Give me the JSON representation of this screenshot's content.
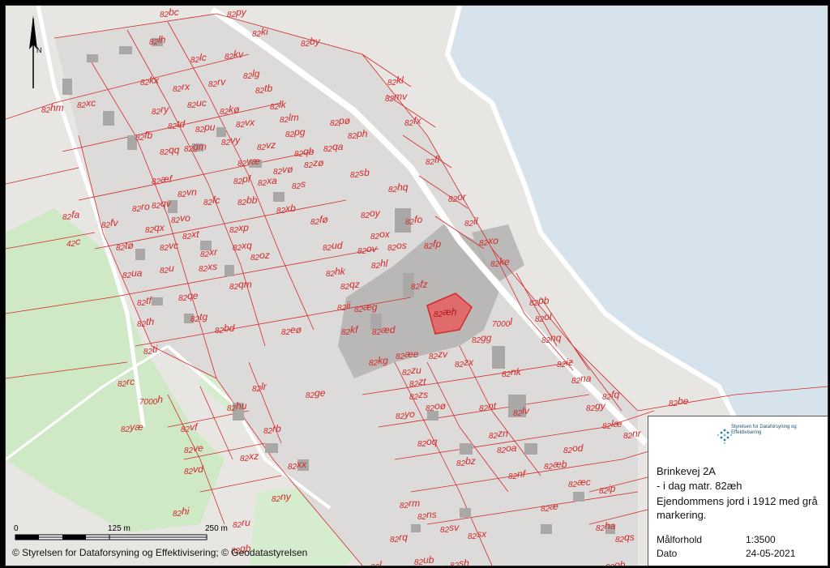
{
  "map": {
    "colors": {
      "water": "#d7e3ec",
      "land": "#e8e6e3",
      "green": "#cfe8c6",
      "built_area": "#d9d8d6",
      "highlight_gray": "#a8a8a8",
      "parcel_line": "#d42a2a",
      "highlight_parcel": "#e06b6b"
    },
    "parcels": [
      {
        "num": "82",
        "id": "bc"
      },
      {
        "num": "82",
        "id": "py"
      },
      {
        "num": "82",
        "id": "ki"
      },
      {
        "num": "82",
        "id": "by"
      },
      {
        "num": "82",
        "id": "lh"
      },
      {
        "num": "82",
        "id": "lc"
      },
      {
        "num": "82",
        "id": "kv"
      },
      {
        "num": "82",
        "id": "kx"
      },
      {
        "num": "82",
        "id": "lg"
      },
      {
        "num": "82",
        "id": "rx"
      },
      {
        "num": "82",
        "id": "rv"
      },
      {
        "num": "82",
        "id": "kl"
      },
      {
        "num": "82",
        "id": "mv"
      },
      {
        "num": "82",
        "id": "tb"
      },
      {
        "num": "82",
        "id": "hm"
      },
      {
        "num": "82",
        "id": "xc"
      },
      {
        "num": "82",
        "id": "uc"
      },
      {
        "num": "82",
        "id": "lk"
      },
      {
        "num": "82",
        "id": "ry"
      },
      {
        "num": "82",
        "id": "kø"
      },
      {
        "num": "82",
        "id": "lm"
      },
      {
        "num": "82",
        "id": "fx"
      },
      {
        "num": "82",
        "id": "td"
      },
      {
        "num": "82",
        "id": "pø"
      },
      {
        "num": "82",
        "id": "vx"
      },
      {
        "num": "82",
        "id": "pg"
      },
      {
        "num": "82",
        "id": "pu"
      },
      {
        "num": "82",
        "id": "ph"
      },
      {
        "num": "82",
        "id": "fb"
      },
      {
        "num": "82",
        "id": "vy"
      },
      {
        "num": "82",
        "id": "vz"
      },
      {
        "num": "82",
        "id": "gm"
      },
      {
        "num": "82",
        "id": "qa"
      },
      {
        "num": "82",
        "id": "qb"
      },
      {
        "num": "82",
        "id": "qq"
      },
      {
        "num": "82",
        "id": "fl"
      },
      {
        "num": "82",
        "id": "væ"
      },
      {
        "num": "82",
        "id": "zø"
      },
      {
        "num": "82",
        "id": "vø"
      },
      {
        "num": "82",
        "id": "sb"
      },
      {
        "num": "82",
        "id": "æf"
      },
      {
        "num": "82",
        "id": "pf"
      },
      {
        "num": "82",
        "id": "xa"
      },
      {
        "num": "82",
        "id": "hq"
      },
      {
        "num": "82",
        "id": "vn"
      },
      {
        "num": "82",
        "id": "s"
      },
      {
        "num": "82",
        "id": "or"
      },
      {
        "num": "82",
        "id": "fc"
      },
      {
        "num": "82",
        "id": "bb"
      },
      {
        "num": "82",
        "id": "qv"
      },
      {
        "num": "82",
        "id": "ro"
      },
      {
        "num": "82",
        "id": "xb"
      },
      {
        "num": "82",
        "id": "oy"
      },
      {
        "num": "82",
        "id": "fa"
      },
      {
        "num": "82",
        "id": "vo"
      },
      {
        "num": "82",
        "id": "fø"
      },
      {
        "num": "82",
        "id": "fo"
      },
      {
        "num": "82",
        "id": "il"
      },
      {
        "num": "82",
        "id": "fv"
      },
      {
        "num": "82",
        "id": "qx"
      },
      {
        "num": "82",
        "id": "xp"
      },
      {
        "num": "42",
        "id": "c"
      },
      {
        "num": "82",
        "id": "xt"
      },
      {
        "num": "82",
        "id": "ox"
      },
      {
        "num": "82",
        "id": "fp"
      },
      {
        "num": "82",
        "id": "xo"
      },
      {
        "num": "82",
        "id": "tø"
      },
      {
        "num": "82",
        "id": "vc"
      },
      {
        "num": "82",
        "id": "xq"
      },
      {
        "num": "82",
        "id": "ud"
      },
      {
        "num": "82",
        "id": "ov"
      },
      {
        "num": "82",
        "id": "os"
      },
      {
        "num": "82",
        "id": "xr"
      },
      {
        "num": "82",
        "id": "oz"
      },
      {
        "num": "82",
        "id": "ke"
      },
      {
        "num": "82",
        "id": "u"
      },
      {
        "num": "82",
        "id": "xs"
      },
      {
        "num": "82",
        "id": "hl"
      },
      {
        "num": "82",
        "id": "ua"
      },
      {
        "num": "82",
        "id": "hk"
      },
      {
        "num": "82",
        "id": "qm"
      },
      {
        "num": "82",
        "id": "qz"
      },
      {
        "num": "82",
        "id": "fz"
      },
      {
        "num": "82",
        "id": "tf"
      },
      {
        "num": "82",
        "id": "qe"
      },
      {
        "num": "82",
        "id": "pb"
      },
      {
        "num": "82",
        "id": "ii"
      },
      {
        "num": "82",
        "id": "æg"
      },
      {
        "num": "82",
        "id": "æh"
      },
      {
        "num": "82",
        "id": "ol"
      },
      {
        "num": "82",
        "id": "th"
      },
      {
        "num": "82",
        "id": "tg"
      },
      {
        "num": "7000",
        "id": "l"
      },
      {
        "num": "82",
        "id": "bd"
      },
      {
        "num": "82",
        "id": "eø"
      },
      {
        "num": "82",
        "id": "kf"
      },
      {
        "num": "82",
        "id": "æd"
      },
      {
        "num": "82",
        "id": "gg"
      },
      {
        "num": "82",
        "id": "nq"
      },
      {
        "num": "82",
        "id": "ti"
      },
      {
        "num": "82",
        "id": "æe"
      },
      {
        "num": "82",
        "id": "zv"
      },
      {
        "num": "82",
        "id": "kg"
      },
      {
        "num": "82",
        "id": "iz"
      },
      {
        "num": "82",
        "id": "zx"
      },
      {
        "num": "82",
        "id": "zu"
      },
      {
        "num": "82",
        "id": "nk"
      },
      {
        "num": "82",
        "id": "rc"
      },
      {
        "num": "82",
        "id": "na"
      },
      {
        "num": "82",
        "id": "lr"
      },
      {
        "num": "82",
        "id": "zt"
      },
      {
        "num": "82",
        "id": "fq"
      },
      {
        "num": "82",
        "id": "ge"
      },
      {
        "num": "82",
        "id": "zs"
      },
      {
        "num": "82",
        "id": "gy"
      },
      {
        "num": "7000",
        "id": "h"
      },
      {
        "num": "82",
        "id": "be"
      },
      {
        "num": "82",
        "id": "hu"
      },
      {
        "num": "82",
        "id": "oø"
      },
      {
        "num": "82",
        "id": "nt"
      },
      {
        "num": "82",
        "id": "lv"
      },
      {
        "num": "82",
        "id": "yo"
      },
      {
        "num": "82",
        "id": "læ"
      },
      {
        "num": "82",
        "id": "yæ"
      },
      {
        "num": "82",
        "id": "vf"
      },
      {
        "num": "82",
        "id": "rb"
      },
      {
        "num": "82",
        "id": "zn"
      },
      {
        "num": "82",
        "id": "nr"
      },
      {
        "num": "82",
        "id": "oq"
      },
      {
        "num": "82",
        "id": "oa"
      },
      {
        "num": "82",
        "id": "ve"
      },
      {
        "num": "82",
        "id": "od"
      },
      {
        "num": "82",
        "id": "xz"
      },
      {
        "num": "82",
        "id": "bz"
      },
      {
        "num": "82",
        "id": "xx"
      },
      {
        "num": "82",
        "id": "æb"
      },
      {
        "num": "82",
        "id": "vd"
      },
      {
        "num": "82",
        "id": "nf"
      },
      {
        "num": "82",
        "id": "æc"
      },
      {
        "num": "82",
        "id": "ny"
      },
      {
        "num": "82",
        "id": "ip"
      },
      {
        "num": "82",
        "id": "æ"
      },
      {
        "num": "82",
        "id": "rm"
      },
      {
        "num": "82",
        "id": "hi"
      },
      {
        "num": "82",
        "id": "ns"
      },
      {
        "num": "82",
        "id": "ru"
      },
      {
        "num": "82",
        "id": "ha"
      },
      {
        "num": "82",
        "id": "sv"
      },
      {
        "num": "82",
        "id": "sx"
      },
      {
        "num": "82",
        "id": "rq"
      },
      {
        "num": "82",
        "id": "qs"
      },
      {
        "num": "82",
        "id": "ub"
      },
      {
        "num": "82",
        "id": "sh"
      },
      {
        "num": "23",
        "id": "l"
      },
      {
        "num": "82",
        "id": "ob"
      },
      {
        "num": "82",
        "id": "gb"
      }
    ],
    "north_arrow_label": "N",
    "scale_labels": [
      "0",
      "125 m",
      "250 m"
    ],
    "copyright": "© Styrelsen for Dataforsyning og Effektivisering; © Geodatastyrelsen"
  },
  "info_box": {
    "logo_icon": "hexagon-dots-logo",
    "logo_text": "Styrelsen for Dataforsyning og Effektivisering",
    "address": "Brinkevej 2A",
    "matr": "- i dag matr. 82æh",
    "description": "Ejendommens jord i 1912 med grå markering.",
    "scale_label": "Målforhold",
    "scale_value": "1:3500",
    "date_label": "Dato",
    "date_value": "24-05-2021"
  }
}
